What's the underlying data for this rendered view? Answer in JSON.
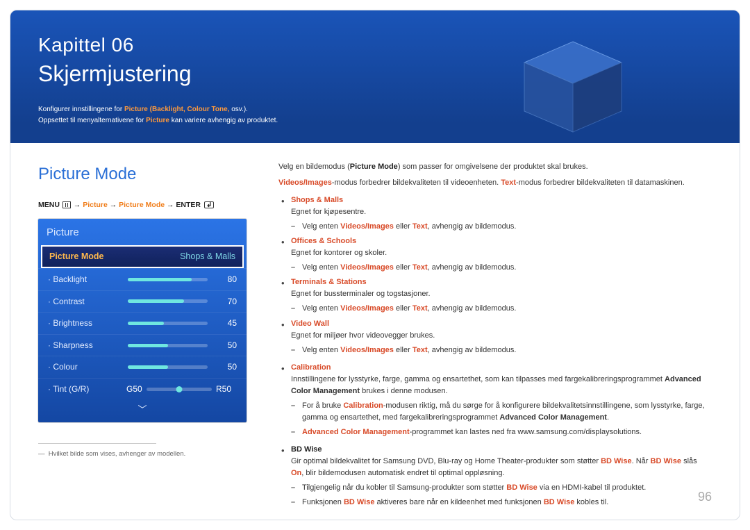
{
  "header": {
    "chapter": "Kapittel 06",
    "title": "Skjermjustering",
    "intro_prefix": "Konfigurer innstillingene for ",
    "intro_accent": "Picture (Backlight, Colour Tone,",
    "intro_suffix": " osv.).",
    "intro_line2_a": "Oppsettet til menyalternativene for ",
    "intro_line2_accent": "Picture",
    "intro_line2_b": " kan variere avhengig av produktet."
  },
  "left": {
    "section_title": "Picture Mode",
    "breadcrumb": {
      "menu": "MENU",
      "p1": "Picture",
      "p2": "Picture Mode",
      "enter": "ENTER"
    },
    "osd": {
      "title": "Picture",
      "selected_label": "Picture Mode",
      "selected_value": "Shops & Malls",
      "rows": [
        {
          "label": "Backlight",
          "value": 80
        },
        {
          "label": "Contrast",
          "value": 70
        },
        {
          "label": "Brightness",
          "value": 45
        },
        {
          "label": "Sharpness",
          "value": 50
        },
        {
          "label": "Colour",
          "value": 50
        }
      ],
      "tint": {
        "label": "Tint (G/R)",
        "left": "G50",
        "right": "R50"
      }
    },
    "footnote_marker": "―",
    "footnote": "Hvilket bilde som vises, avhenger av modellen."
  },
  "right": {
    "p1_a": "Velg en bildemodus (",
    "p1_bold": "Picture Mode",
    "p1_b": ") som passer for omgivelsene der produktet skal brukes.",
    "p2_a": "Videos/Images",
    "p2_b": "-modus forbedrer bildekvaliteten til videoenheten. ",
    "p2_c": "Text",
    "p2_d": "-modus forbedrer bildekvaliteten til datamaskinen.",
    "items": [
      {
        "hd": "Shops & Malls",
        "desc": "Egnet for kjøpesentre.",
        "dash": [
          {
            "pre": "Velg enten ",
            "r1": "Videos/Images",
            "mid": " eller ",
            "r2": "Text",
            "post": ", avhengig av bildemodus."
          }
        ]
      },
      {
        "hd": "Offices & Schools",
        "desc": "Egnet for kontorer og skoler.",
        "dash": [
          {
            "pre": "Velg enten ",
            "r1": "Videos/Images",
            "mid": " eller ",
            "r2": "Text",
            "post": ", avhengig av bildemodus."
          }
        ]
      },
      {
        "hd": "Terminals & Stations",
        "desc": "Egnet for bussterminaler og togstasjoner.",
        "dash": [
          {
            "pre": "Velg enten ",
            "r1": "Videos/Images",
            "mid": " eller ",
            "r2": "Text",
            "post": ", avhengig av bildemodus."
          }
        ]
      },
      {
        "hd": "Video Wall",
        "desc": "Egnet for miljøer hvor videovegger brukes.",
        "dash": [
          {
            "pre": "Velg enten ",
            "r1": "Videos/Images",
            "mid": " eller ",
            "r2": "Text",
            "post": ", avhengig av bildemodus."
          }
        ]
      }
    ],
    "calibration": {
      "hd": "Calibration",
      "desc_a": "Innstillingene for lysstyrke, farge, gamma og ensartethet, som kan tilpasses med fargekalibreringsprogrammet ",
      "desc_bold": "Advanced Color Management",
      "desc_b": " brukes i denne modusen.",
      "dash1_a": "For å bruke ",
      "dash1_r": "Calibration",
      "dash1_b": "-modusen riktig, må du sørge for å konfigurere bildekvalitetsinnstillingene, som lysstyrke, farge, gamma og ensartethet, med fargekalibreringsprogrammet ",
      "dash1_bold": "Advanced Color Management",
      "dash1_c": ".",
      "dash2_r": "Advanced Color Management",
      "dash2_b": "-programmet kan lastes ned fra www.samsung.com/displaysolutions."
    },
    "bdwise": {
      "hd": "BD Wise",
      "desc_a": "Gir optimal bildekvalitet for Samsung DVD, Blu-ray og Home Theater-produkter som støtter ",
      "desc_r1": "BD Wise",
      "desc_b": ". Når ",
      "desc_r2": "BD Wise",
      "desc_c": " slås ",
      "desc_r3": "On",
      "desc_d": ", blir bildemodusen automatisk endret til optimal oppløsning.",
      "dash1_a": "Tilgjengelig når du kobler til Samsung-produkter som støtter ",
      "dash1_r": "BD Wise",
      "dash1_b": " via en HDMI-kabel til produktet.",
      "dash2_a": "Funksjonen ",
      "dash2_r1": "BD Wise",
      "dash2_b": " aktiveres bare når en kildeenhet med funksjonen ",
      "dash2_r2": "BD Wise",
      "dash2_c": " kobles til."
    }
  },
  "page_number": "96"
}
